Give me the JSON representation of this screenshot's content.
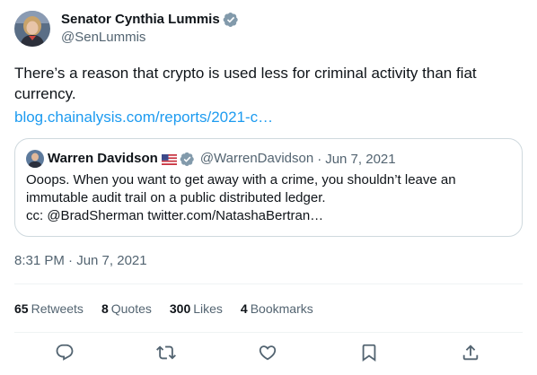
{
  "author": {
    "display_name": "Senator Cynthia Lummis",
    "handle": "@SenLummis"
  },
  "tweet": {
    "text": "There’s a reason that crypto is used less for criminal activity than fiat currency.",
    "link_text": "blog.chainalysis.com/reports/2021-c…"
  },
  "quote": {
    "display_name": "Warren Davidson",
    "flag": "US flag",
    "handle": "@WarrenDavidson",
    "separator": "·",
    "date": "Jun 7, 2021",
    "text": "Ooops. When you want to get away with a crime, you shouldn’t leave an immutable audit trail on a public distributed ledger.",
    "cc_line": "cc: @BradSherman twitter.com/NatashaBertran…"
  },
  "meta": {
    "timestamp": "8:31 PM · Jun 7, 2021"
  },
  "stats": [
    {
      "count": "65",
      "label": "Retweets"
    },
    {
      "count": "8",
      "label": "Quotes"
    },
    {
      "count": "300",
      "label": "Likes"
    },
    {
      "count": "4",
      "label": "Bookmarks"
    }
  ],
  "actions": [
    {
      "name": "reply",
      "icon": "reply-icon"
    },
    {
      "name": "retweet",
      "icon": "retweet-icon"
    },
    {
      "name": "like",
      "icon": "heart-icon"
    },
    {
      "name": "bookmark",
      "icon": "bookmark-icon"
    },
    {
      "name": "share",
      "icon": "share-icon"
    }
  ],
  "colors": {
    "text": "#0f1419",
    "muted": "#536471",
    "link": "#1d9bf0",
    "border": "#cfd9de",
    "verified": "#829aab"
  }
}
